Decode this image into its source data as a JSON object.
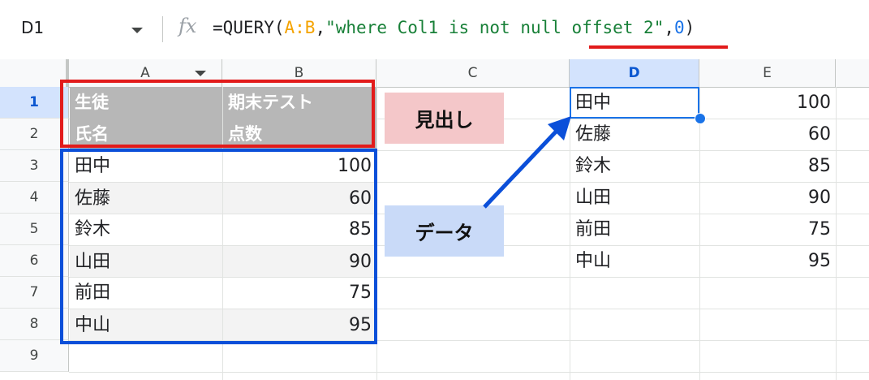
{
  "formula_bar": {
    "name_box": "D1",
    "fx_label": "fx",
    "formula_prefix": "=QUERY(",
    "formula_range": "A:B",
    "formula_comma1": ",",
    "formula_string": "\"where Col1 is not null offset 2\"",
    "formula_comma2": ",",
    "formula_number": "0",
    "formula_suffix": ")"
  },
  "columns": [
    "A",
    "B",
    "C",
    "D",
    "E"
  ],
  "rows": [
    "1",
    "2",
    "3",
    "4",
    "5",
    "6",
    "7",
    "8",
    "9"
  ],
  "cells": {
    "A1": "生徒",
    "B1": "期末テスト",
    "A2": "氏名",
    "B2": "点数",
    "A3": "田中",
    "B3": "100",
    "A4": "佐藤",
    "B4": "60",
    "A5": "鈴木",
    "B5": "85",
    "A6": "山田",
    "B6": "90",
    "A7": "前田",
    "B7": "75",
    "A8": "中山",
    "B8": "95",
    "D1": "田中",
    "E1": "100",
    "D2": "佐藤",
    "E2": "60",
    "D3": "鈴木",
    "E3": "85",
    "D4": "山田",
    "E4": "90",
    "D5": "前田",
    "E5": "75",
    "D6": "中山",
    "E6": "95"
  },
  "annotations": {
    "header_label": "見出し",
    "data_label": "データ"
  },
  "colors": {
    "header_fill": "#b7b7b7",
    "band_fill": "#f3f3f3",
    "red_frame": "#e21b1b",
    "blue_frame": "#0b4fd9",
    "selection": "#1a73e8"
  }
}
